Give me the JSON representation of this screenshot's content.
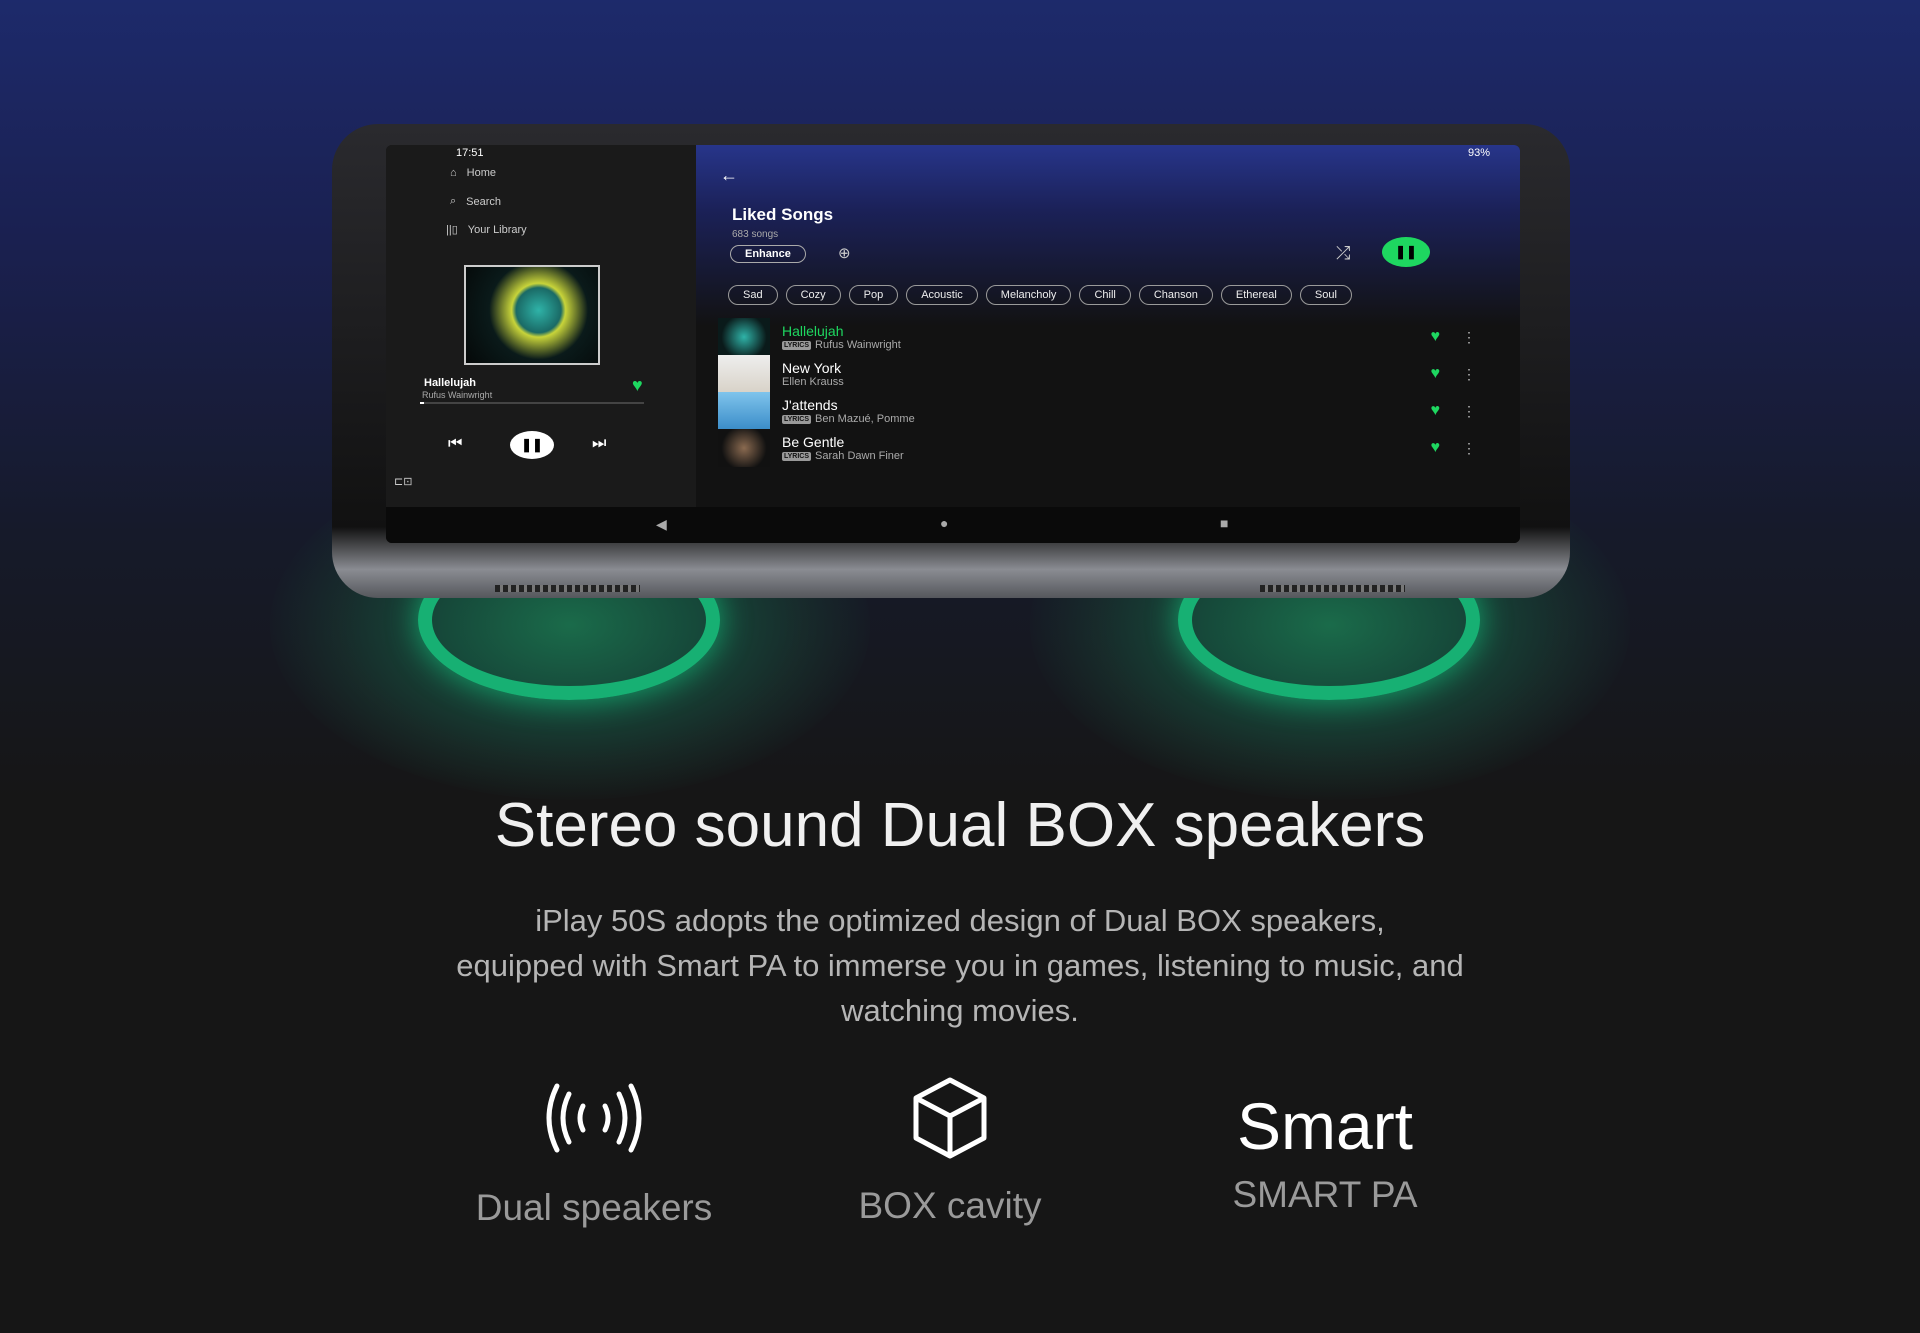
{
  "status_bar": {
    "time": "17:51",
    "battery": "93%"
  },
  "sidebar": {
    "items": [
      {
        "label": "Home",
        "icon": "home-icon"
      },
      {
        "label": "Search",
        "icon": "search-icon"
      },
      {
        "label": "Your Library",
        "icon": "library-icon"
      }
    ],
    "now_playing": {
      "title": "Hallelujah",
      "artist": "Rufus Wainwright",
      "progress": 0.02
    }
  },
  "playlist": {
    "title": "Liked Songs",
    "count": "683 songs",
    "enhance_label": "Enhance",
    "filters": [
      "Sad",
      "Cozy",
      "Pop",
      "Acoustic",
      "Melancholy",
      "Chill",
      "Chanson",
      "Ethereal",
      "Soul"
    ],
    "tracks": [
      {
        "title": "Hallelujah",
        "artist": "Rufus Wainwright",
        "lyrics": "LYRICS",
        "playing": true
      },
      {
        "title": "New York",
        "artist": "Ellen Krauss",
        "lyrics": ""
      },
      {
        "title": "J'attends",
        "artist": "Ben Mazué, Pomme",
        "lyrics": "LYRICS"
      },
      {
        "title": "Be Gentle",
        "artist": "Sarah Dawn Finer",
        "lyrics": "LYRICS"
      }
    ]
  },
  "colors": {
    "accent": "#1ed760",
    "background": "#161616"
  },
  "headline": "Stereo sound Dual BOX speakers",
  "description": [
    "iPlay 50S adopts the optimized design of Dual BOX speakers,",
    "equipped with Smart PA to immerse you in games, listening to music, and",
    "watching movies."
  ],
  "features": [
    {
      "label": "Dual speakers",
      "icon": "speaker-waves-icon"
    },
    {
      "label": "BOX cavity",
      "icon": "cube-icon"
    },
    {
      "big": "Smart",
      "label": "SMART PA"
    }
  ]
}
